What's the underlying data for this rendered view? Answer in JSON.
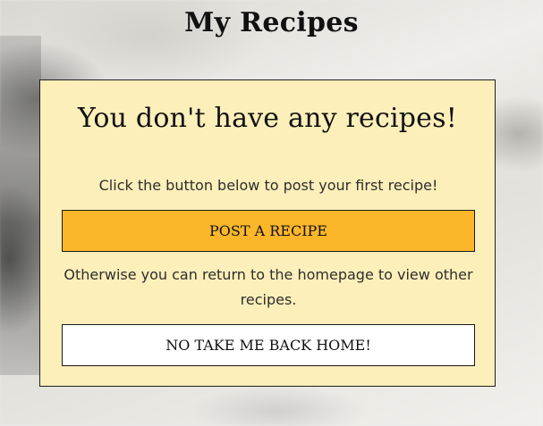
{
  "page": {
    "title": "My Recipes"
  },
  "empty_state": {
    "heading": "You don't have any recipes!",
    "prompt_text": "Click the button below to post your first recipe!",
    "post_button_label": "POST A RECIPE",
    "alternative_text": "Otherwise you can return to the homepage to view other recipes.",
    "home_button_label": "NO TAKE ME BACK HOME!"
  },
  "colors": {
    "card_background": "#fcefb9",
    "primary_button": "#fbb62a",
    "secondary_button": "#ffffff"
  }
}
